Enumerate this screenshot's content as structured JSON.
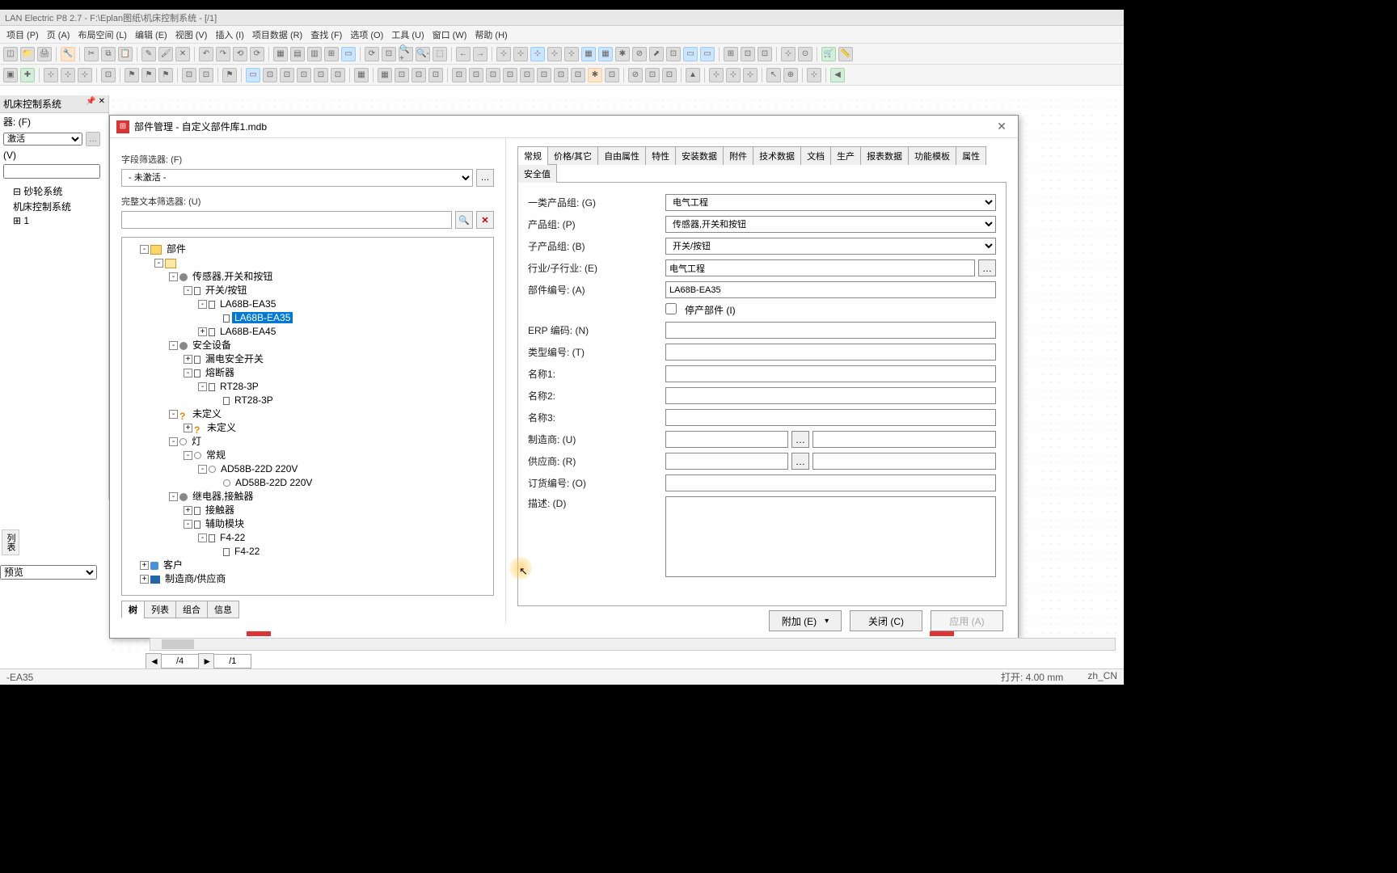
{
  "title_bar": "LAN Electric P8 2.7 - F:\\Eplan图纸\\机床控制系统 - [/1]",
  "menu": [
    "项目 (P)",
    "页 (A)",
    "布局空间 (L)",
    "编辑 (E)",
    "视图 (V)",
    "插入 (I)",
    "项目数据 (R)",
    "查找 (F)",
    "选项 (O)",
    "工具 (U)",
    "窗口 (W)",
    "帮助 (H)"
  ],
  "left_panel": {
    "header": "机床控制系统",
    "filter_label": "器: (F)",
    "filter_value": "激活",
    "value_label": "(V)",
    "tree": [
      "⊟ 砂轮系统",
      "  机床控制系统",
      "⊞ 1"
    ],
    "preview_tab": "列表",
    "preview_combo": "预览"
  },
  "dialog": {
    "title": "部件管理 - 自定义部件库1.mdb",
    "filter_field_label": "字段筛选器: (F)",
    "filter_field_value": "- 未激活 -",
    "filter_text_label": "完整文本筛选器: (U)",
    "filter_text_value": "",
    "tree": [
      {
        "d": 1,
        "t": "-",
        "i": "folder",
        "l": "部件"
      },
      {
        "d": 2,
        "t": "-",
        "i": "folder-o",
        "l": ""
      },
      {
        "d": 3,
        "t": "-",
        "i": "gear",
        "l": "传感器,开关和按钮"
      },
      {
        "d": 4,
        "t": "-",
        "i": "sw",
        "l": "开关/按钮"
      },
      {
        "d": 5,
        "t": "-",
        "i": "sw",
        "l": "LA68B-EA35"
      },
      {
        "d": 6,
        "t": "",
        "i": "sw",
        "l": "LA68B-EA35",
        "sel": true
      },
      {
        "d": 5,
        "t": "+",
        "i": "sw",
        "l": "LA68B-EA45"
      },
      {
        "d": 3,
        "t": "-",
        "i": "gear",
        "l": "安全设备"
      },
      {
        "d": 4,
        "t": "+",
        "i": "sw",
        "l": "漏电安全开关"
      },
      {
        "d": 4,
        "t": "-",
        "i": "sw",
        "l": "熔断器"
      },
      {
        "d": 5,
        "t": "-",
        "i": "sw",
        "l": "RT28-3P"
      },
      {
        "d": 6,
        "t": "",
        "i": "sw",
        "l": "RT28-3P"
      },
      {
        "d": 3,
        "t": "-",
        "i": "q",
        "l": "未定义"
      },
      {
        "d": 4,
        "t": "+",
        "i": "q",
        "l": "未定义"
      },
      {
        "d": 3,
        "t": "-",
        "i": "lamp",
        "l": "灯"
      },
      {
        "d": 4,
        "t": "-",
        "i": "lamp",
        "l": "常规"
      },
      {
        "d": 5,
        "t": "-",
        "i": "lamp",
        "l": "AD58B-22D  220V"
      },
      {
        "d": 6,
        "t": "",
        "i": "lamp",
        "l": "AD58B-22D  220V"
      },
      {
        "d": 3,
        "t": "-",
        "i": "gear",
        "l": "继电器,接触器"
      },
      {
        "d": 4,
        "t": "+",
        "i": "sw",
        "l": "接触器"
      },
      {
        "d": 4,
        "t": "-",
        "i": "sw",
        "l": "辅助模块"
      },
      {
        "d": 5,
        "t": "-",
        "i": "sw",
        "l": "F4-22"
      },
      {
        "d": 6,
        "t": "",
        "i": "sw",
        "l": "F4-22"
      },
      {
        "d": 1,
        "t": "+",
        "i": "person",
        "l": "客户"
      },
      {
        "d": 1,
        "t": "+",
        "i": "factory",
        "l": "制造商/供应商"
      }
    ],
    "bottom_tabs": [
      "树",
      "列表",
      "组合",
      "信息"
    ],
    "bottom_tab_active": 0,
    "right_tabs": [
      "常规",
      "价格/其它",
      "自由属性",
      "特性",
      "安装数据",
      "附件",
      "技术数据",
      "文档",
      "生产",
      "报表数据",
      "功能模板",
      "属性",
      "安全值"
    ],
    "right_tab_active": 0,
    "form": {
      "product_group_main": {
        "label": "一类产品组: (G)",
        "value": "电气工程"
      },
      "product_group": {
        "label": "产品组: (P)",
        "value": "传感器,开关和按钮"
      },
      "product_subgroup": {
        "label": "子产品组: (B)",
        "value": "开关/按钮"
      },
      "industry": {
        "label": "行业/子行业: (E)",
        "value": "电气工程"
      },
      "part_number": {
        "label": "部件编号: (A)",
        "value": "LA68B-EA35"
      },
      "discontinued": {
        "label": "停产部件 (I)",
        "checked": false
      },
      "erp": {
        "label": "ERP 编码: (N)",
        "value": ""
      },
      "type_number": {
        "label": "类型编号: (T)",
        "value": ""
      },
      "name1": {
        "label": "名称1:",
        "value": ""
      },
      "name2": {
        "label": "名称2:",
        "value": ""
      },
      "name3": {
        "label": "名称3:",
        "value": ""
      },
      "manufacturer": {
        "label": "制造商: (U)",
        "value": "",
        "extra": ""
      },
      "supplier": {
        "label": "供应商: (R)",
        "value": "",
        "extra": ""
      },
      "order_number": {
        "label": "订货编号: (O)",
        "value": ""
      },
      "description": {
        "label": "描述: (D)",
        "value": ""
      }
    },
    "buttons": {
      "attach": "附加 (E)",
      "close": "关闭 (C)",
      "apply": "应用 (A)"
    }
  },
  "page_tabs": {
    "nav_prev": "◄",
    "nav_next": "►",
    "pages": [
      "/4",
      "/1"
    ]
  },
  "status": {
    "left": "-EA35",
    "open": "打开: 4.00 mm",
    "lang": "zh_CN"
  }
}
